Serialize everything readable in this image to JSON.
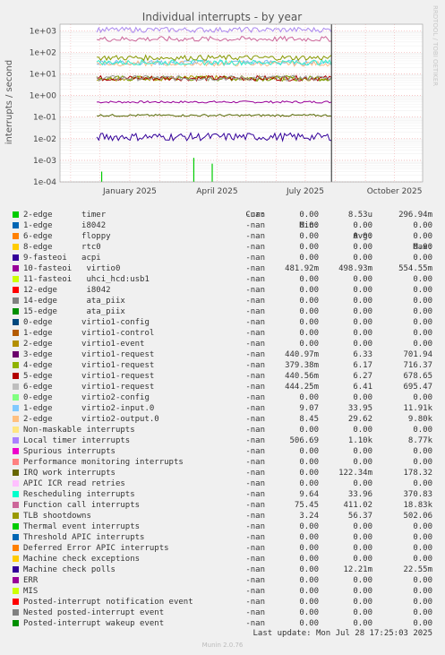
{
  "chart_data": {
    "type": "line",
    "title": "Individual interrupts - by year",
    "ylabel": "interrupts / second",
    "watermark": "RRDTOOL / TOBI OETIKER",
    "yscale": "log",
    "ylim": [
      0.0001,
      2000
    ],
    "y_ticks": [
      "1e+03",
      "1e+02",
      "1e+01",
      "1e+00",
      "1e-01",
      "1e-02",
      "1e-03",
      "1e-04"
    ],
    "y_tick_values": [
      1000,
      100,
      10,
      1,
      0.1,
      0.01,
      0.001,
      0.0001
    ],
    "x_ticks": [
      "January 2025",
      "April 2025",
      "July 2025",
      "October 2025"
    ],
    "x_tick_values": [
      "2025-01-01",
      "2025-04-01",
      "2025-07-01",
      "2025-10-01"
    ],
    "x_range": [
      "2024-10-21",
      "2025-10-30"
    ],
    "data_start": "2024-11-28",
    "now": "2025-07-28",
    "grid": true,
    "series": [
      {
        "name": "timer",
        "color": "#00cc00",
        "level": 1e-05,
        "spikes": [
          {
            "date": "2024-12-03",
            "value": 0.0003
          },
          {
            "date": "2025-03-08",
            "value": 0.0013
          },
          {
            "date": "2025-03-27",
            "value": 0.0007
          }
        ]
      },
      {
        "name": "10-fasteoi virtio0",
        "color": "#990099",
        "level": 0.5
      },
      {
        "name": "3-edge virtio1-request",
        "color": "#aa9900",
        "level": 6.3
      },
      {
        "name": "4-edge virtio1-request",
        "color": "#779900",
        "level": 6.2
      },
      {
        "name": "5-edge virtio1-request",
        "color": "#aa0000",
        "level": 6.3
      },
      {
        "name": "6-edge virtio1-request",
        "color": "#999999",
        "level": 6.4
      },
      {
        "name": "1-edge virtio2-input.0",
        "color": "#77bbee",
        "level": 34
      },
      {
        "name": "2-edge virtio2-output.0",
        "color": "#ffbb88",
        "level": 30
      },
      {
        "name": "Local timer interrupts",
        "color": "#aa88ee",
        "level": 1100
      },
      {
        "name": "IRQ work interrupts",
        "color": "#556600",
        "level": 0.12
      },
      {
        "name": "Rescheduling interrupts",
        "color": "#33eecc",
        "level": 34
      },
      {
        "name": "Function call interrupts",
        "color": "#cc6699",
        "level": 411
      },
      {
        "name": "TLB shootdowns",
        "color": "#889900",
        "level": 56
      },
      {
        "name": "Machine check polls",
        "color": "#330099",
        "level": 0.0122
      }
    ]
  },
  "legend": {
    "headers": {
      "cur": "Cur:",
      "min": "Min:",
      "avg": "Avg:",
      "max": "Max:"
    },
    "rows": [
      {
        "label": "2-edge      timer",
        "color": "#00cc00",
        "cur": "-nan",
        "min": "0.00",
        "avg": "8.53u",
        "max": "296.94m"
      },
      {
        "label": "1-edge      i8042",
        "color": "#0066b3",
        "cur": "-nan",
        "min": "0.00",
        "avg": "0.00",
        "max": "0.00"
      },
      {
        "label": "6-edge      floppy",
        "color": "#ff8000",
        "cur": "-nan",
        "min": "0.00",
        "avg": "0.00",
        "max": "0.00"
      },
      {
        "label": "8-edge      rtc0",
        "color": "#ffcc00",
        "cur": "-nan",
        "min": "0.00",
        "avg": "0.00",
        "max": "0.00"
      },
      {
        "label": "9-fasteoi   acpi",
        "color": "#330099",
        "cur": "-nan",
        "min": "0.00",
        "avg": "0.00",
        "max": "0.00"
      },
      {
        "label": "10-fasteoi   virtio0",
        "color": "#990099",
        "cur": "-nan",
        "min": "481.92m",
        "avg": "498.93m",
        "max": "554.55m"
      },
      {
        "label": "11-fasteoi   uhci_hcd:usb1",
        "color": "#ccff00",
        "cur": "-nan",
        "min": "0.00",
        "avg": "0.00",
        "max": "0.00"
      },
      {
        "label": "12-edge      i8042",
        "color": "#ff0000",
        "cur": "-nan",
        "min": "0.00",
        "avg": "0.00",
        "max": "0.00"
      },
      {
        "label": "14-edge      ata_piix",
        "color": "#808080",
        "cur": "-nan",
        "min": "0.00",
        "avg": "0.00",
        "max": "0.00"
      },
      {
        "label": "15-edge      ata_piix",
        "color": "#008f00",
        "cur": "-nan",
        "min": "0.00",
        "avg": "0.00",
        "max": "0.00"
      },
      {
        "label": "0-edge      virtio1-config",
        "color": "#00487d",
        "cur": "-nan",
        "min": "0.00",
        "avg": "0.00",
        "max": "0.00"
      },
      {
        "label": "1-edge      virtio1-control",
        "color": "#b35a00",
        "cur": "-nan",
        "min": "0.00",
        "avg": "0.00",
        "max": "0.00"
      },
      {
        "label": "2-edge      virtio1-event",
        "color": "#b38f00",
        "cur": "-nan",
        "min": "0.00",
        "avg": "0.00",
        "max": "0.00"
      },
      {
        "label": "3-edge      virtio1-request",
        "color": "#6b006b",
        "cur": "-nan",
        "min": "440.97m",
        "avg": "6.33",
        "max": "701.94"
      },
      {
        "label": "4-edge      virtio1-request",
        "color": "#8fb300",
        "cur": "-nan",
        "min": "379.38m",
        "avg": "6.17",
        "max": "716.37"
      },
      {
        "label": "5-edge      virtio1-request",
        "color": "#b30000",
        "cur": "-nan",
        "min": "440.56m",
        "avg": "6.27",
        "max": "678.65"
      },
      {
        "label": "6-edge      virtio1-request",
        "color": "#bebebe",
        "cur": "-nan",
        "min": "444.25m",
        "avg": "6.41",
        "max": "695.47"
      },
      {
        "label": "0-edge      virtio2-config",
        "color": "#80ff80",
        "cur": "-nan",
        "min": "0.00",
        "avg": "0.00",
        "max": "0.00"
      },
      {
        "label": "1-edge      virtio2-input.0",
        "color": "#80c9ff",
        "cur": "-nan",
        "min": "9.07",
        "avg": "33.95",
        "max": "11.91k"
      },
      {
        "label": "2-edge      virtio2-output.0",
        "color": "#ffc080",
        "cur": "-nan",
        "min": "8.45",
        "avg": "29.62",
        "max": "9.80k"
      },
      {
        "label": "Non-maskable interrupts",
        "color": "#ffe680",
        "cur": "-nan",
        "min": "0.00",
        "avg": "0.00",
        "max": "0.00"
      },
      {
        "label": "Local timer interrupts",
        "color": "#aa80ff",
        "cur": "-nan",
        "min": "506.69",
        "avg": "1.10k",
        "max": "8.77k"
      },
      {
        "label": "Spurious interrupts",
        "color": "#ee00cc",
        "cur": "-nan",
        "min": "0.00",
        "avg": "0.00",
        "max": "0.00"
      },
      {
        "label": "Performance monitoring interrupts",
        "color": "#ff8080",
        "cur": "-nan",
        "min": "0.00",
        "avg": "0.00",
        "max": "0.00"
      },
      {
        "label": "IRQ work interrupts",
        "color": "#666600",
        "cur": "-nan",
        "min": "0.00",
        "avg": "122.34m",
        "max": "178.32"
      },
      {
        "label": "APIC ICR read retries",
        "color": "#ffbfff",
        "cur": "-nan",
        "min": "0.00",
        "avg": "0.00",
        "max": "0.00"
      },
      {
        "label": "Rescheduling interrupts",
        "color": "#00ffcc",
        "cur": "-nan",
        "min": "9.64",
        "avg": "33.96",
        "max": "370.83"
      },
      {
        "label": "Function call interrupts",
        "color": "#cc6699",
        "cur": "-nan",
        "min": "75.45",
        "avg": "411.02",
        "max": "18.83k"
      },
      {
        "label": "TLB shootdowns",
        "color": "#999900",
        "cur": "-nan",
        "min": "3.24",
        "avg": "56.37",
        "max": "502.06"
      },
      {
        "label": "Thermal event interrupts",
        "color": "#00cc00",
        "cur": "-nan",
        "min": "0.00",
        "avg": "0.00",
        "max": "0.00"
      },
      {
        "label": "Threshold APIC interrupts",
        "color": "#0066b3",
        "cur": "-nan",
        "min": "0.00",
        "avg": "0.00",
        "max": "0.00"
      },
      {
        "label": "Deferred Error APIC interrupts",
        "color": "#ff8000",
        "cur": "-nan",
        "min": "0.00",
        "avg": "0.00",
        "max": "0.00"
      },
      {
        "label": "Machine check exceptions",
        "color": "#ffcc00",
        "cur": "-nan",
        "min": "0.00",
        "avg": "0.00",
        "max": "0.00"
      },
      {
        "label": "Machine check polls",
        "color": "#330099",
        "cur": "-nan",
        "min": "0.00",
        "avg": "12.21m",
        "max": "22.55m"
      },
      {
        "label": "ERR",
        "color": "#990099",
        "cur": "-nan",
        "min": "0.00",
        "avg": "0.00",
        "max": "0.00"
      },
      {
        "label": "MIS",
        "color": "#ccff00",
        "cur": "-nan",
        "min": "0.00",
        "avg": "0.00",
        "max": "0.00"
      },
      {
        "label": "Posted-interrupt notification event",
        "color": "#ff0000",
        "cur": "-nan",
        "min": "0.00",
        "avg": "0.00",
        "max": "0.00"
      },
      {
        "label": "Nested posted-interrupt event",
        "color": "#808080",
        "cur": "-nan",
        "min": "0.00",
        "avg": "0.00",
        "max": "0.00"
      },
      {
        "label": "Posted-interrupt wakeup event",
        "color": "#008f00",
        "cur": "-nan",
        "min": "0.00",
        "avg": "0.00",
        "max": "0.00"
      }
    ]
  },
  "footer": {
    "last_update": "Last update: Mon Jul 28 17:25:03 2025",
    "munin": "Munin 2.0.76"
  }
}
